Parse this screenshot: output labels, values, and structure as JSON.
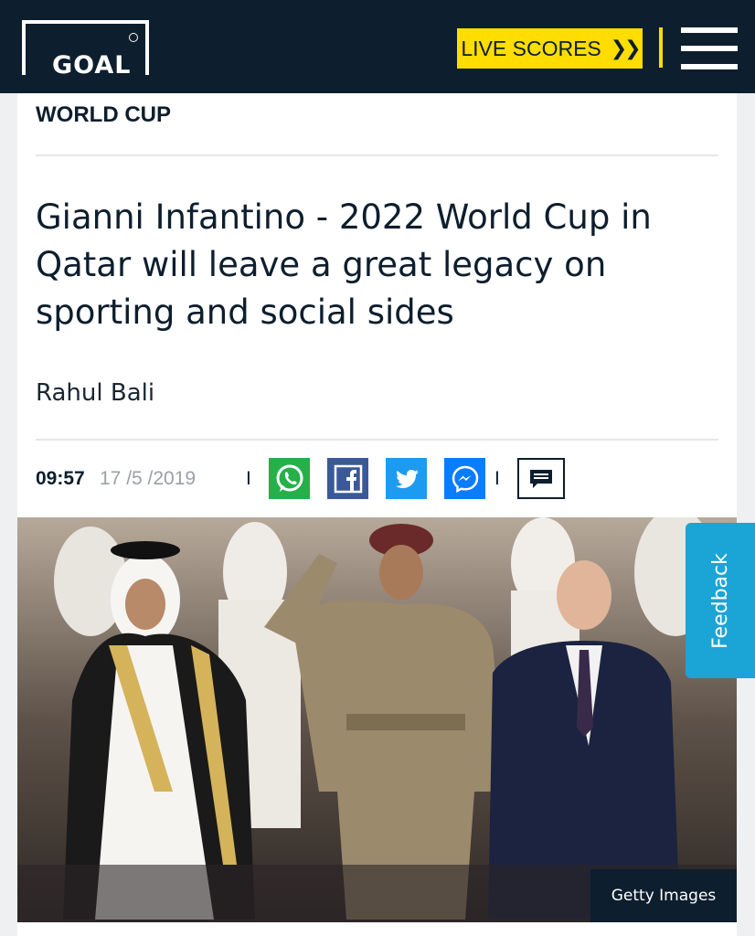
{
  "header": {
    "logo_text": "GOAL",
    "live_scores_label": "LIVE SCORES",
    "live_scores_icon": "double-chevron-right-icon",
    "menu_icon": "hamburger-menu-icon"
  },
  "article": {
    "category": "WORLD CUP",
    "headline": "Gianni Infantino - 2022 World Cup in Qatar will leave a great legacy on sporting and social sides",
    "author": "Rahul Bali",
    "time": "09:57",
    "date": "17 /5 /2019",
    "separator": "I",
    "share_icons": [
      "whatsapp-icon",
      "facebook-icon",
      "twitter-icon",
      "messenger-icon"
    ],
    "comment_icon": "comment-icon",
    "image_credit": "Getty Images"
  },
  "feedback": {
    "label": "Feedback"
  },
  "colors": {
    "navy": "#0d1e2e",
    "yellow": "#ffdd00",
    "whatsapp": "#25b04a",
    "facebook": "#3b5998",
    "twitter": "#1d9bf0",
    "messenger": "#0a7cff",
    "feedback": "#1ba4d6"
  }
}
